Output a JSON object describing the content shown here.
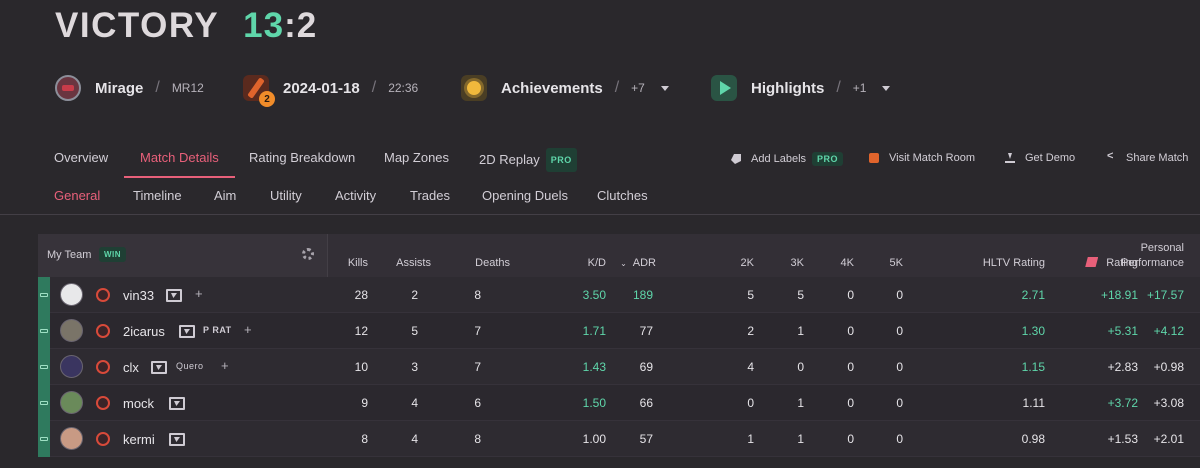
{
  "header": {
    "result": "VICTORY",
    "score_team": "13",
    "score_rest": ":2"
  },
  "info": {
    "map": {
      "icon": "mirage-map-icon",
      "name": "Mirage",
      "format": "MR12"
    },
    "date": {
      "icon": "cs2-icon",
      "badge": "2",
      "date": "2024-01-18",
      "time": "22:36"
    },
    "achievements": {
      "icon": "achievement-sun-icon",
      "label": "Achievements",
      "count": "+7"
    },
    "highlights": {
      "icon": "play-icon",
      "label": "Highlights",
      "count": "+1"
    }
  },
  "tabs_primary": [
    {
      "label": "Overview",
      "active": false
    },
    {
      "label": "Match Details",
      "active": true
    },
    {
      "label": "Rating Breakdown",
      "active": false
    },
    {
      "label": "Map Zones",
      "active": false
    },
    {
      "label": "2D Replay",
      "active": false,
      "badge": "PRO"
    }
  ],
  "actions": [
    {
      "label": "Add Labels",
      "icon": "tag-icon",
      "badge": "PRO"
    },
    {
      "label": "Visit Match Room",
      "icon": "faceit-room-icon"
    },
    {
      "label": "Get Demo",
      "icon": "download-icon"
    },
    {
      "label": "Share Match",
      "icon": "share-icon"
    }
  ],
  "tabs_secondary": [
    {
      "label": "General",
      "active": true
    },
    {
      "label": "Timeline",
      "active": false
    },
    {
      "label": "Aim",
      "active": false
    },
    {
      "label": "Utility",
      "active": false
    },
    {
      "label": "Activity",
      "active": false
    },
    {
      "label": "Trades",
      "active": false
    },
    {
      "label": "Opening Duels",
      "active": false
    },
    {
      "label": "Clutches",
      "active": false
    }
  ],
  "table": {
    "team_label": "My Team",
    "team_badge": "WIN",
    "columns": {
      "kills": "Kills",
      "assists": "Assists",
      "deaths": "Deaths",
      "kd": "K/D",
      "adr": "ADR",
      "k2": "2K",
      "k3": "3K",
      "k4": "4K",
      "k5": "5K",
      "hltv": "HLTV Rating",
      "rating": "Rating",
      "pp_line1": "Personal",
      "pp_line2": "Performance"
    },
    "rows": [
      {
        "name": "vin33",
        "team": "",
        "kills": "28",
        "assists": "2",
        "deaths": "8",
        "kd": "3.50",
        "adr": "189",
        "k2": "5",
        "k3": "5",
        "k4": "0",
        "k5": "0",
        "hltv": "2.71",
        "rating": "+18.91",
        "pp": "+17.57"
      },
      {
        "name": "2icarus",
        "team": "P RAT",
        "kills": "12",
        "assists": "5",
        "deaths": "7",
        "kd": "1.71",
        "adr": "77",
        "k2": "2",
        "k3": "1",
        "k4": "0",
        "k5": "0",
        "hltv": "1.30",
        "rating": "+5.31",
        "pp": "+4.12"
      },
      {
        "name": "clx",
        "team": "Quero",
        "kills": "10",
        "assists": "3",
        "deaths": "7",
        "kd": "1.43",
        "adr": "69",
        "k2": "4",
        "k3": "0",
        "k4": "0",
        "k5": "0",
        "hltv": "1.15",
        "rating": "+2.83",
        "pp": "+0.98"
      },
      {
        "name": "mock",
        "team": "",
        "kills": "9",
        "assists": "4",
        "deaths": "6",
        "kd": "1.50",
        "adr": "66",
        "k2": "0",
        "k3": "1",
        "k4": "0",
        "k5": "0",
        "hltv": "1.11",
        "rating": "+3.72",
        "pp": "+3.08"
      },
      {
        "name": "kermi",
        "team": "",
        "kills": "8",
        "assists": "4",
        "deaths": "8",
        "kd": "1.00",
        "adr": "57",
        "k2": "1",
        "k3": "1",
        "k4": "0",
        "k5": "0",
        "hltv": "0.98",
        "rating": "+1.53",
        "pp": "+2.01"
      }
    ]
  },
  "colors": {
    "accent": "#e8607a",
    "positive": "#5fd6aa",
    "background": "#2a282c"
  }
}
